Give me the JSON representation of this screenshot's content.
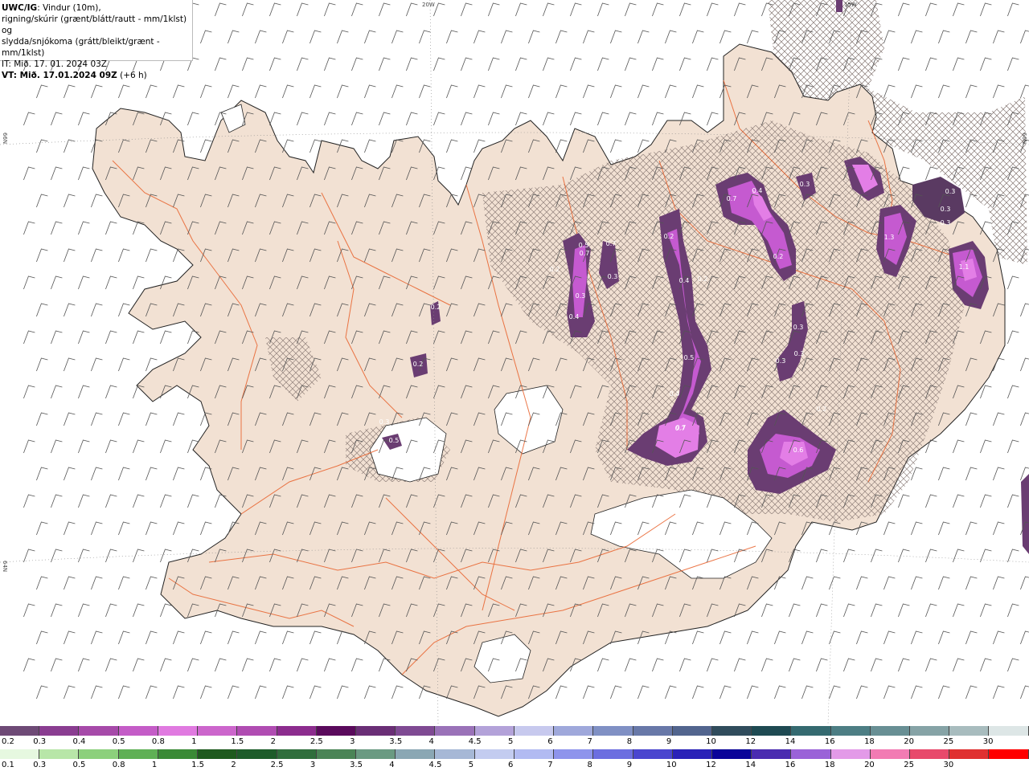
{
  "title": {
    "product": "UWC/IG",
    "line1_rest": ": Vindur (10m),",
    "line2": "rigning/skúrir (grænt/blátt/rautt - mm/1klst) og",
    "line3": "slydda/snjókoma (grátt/bleikt/grænt - mm/1klst)",
    "line4": "IT: Mið. 17. 01. 2024 03Z",
    "line5_bold": "VT: Mið. 17.01.2024 09Z",
    "line5_rest": " (+6 h)"
  },
  "grid_labels": {
    "top_20w": "20W",
    "top_15w": "15W",
    "left_66n": "66N",
    "right_66n": "66N",
    "left_64n": "64N"
  },
  "map_labels": [
    "0.7",
    "0.5",
    "0.2",
    "0.3",
    "0.3",
    "0.4",
    "0.7",
    "0.2",
    "0.2",
    "0.3",
    "0.5",
    "0.2",
    "0.4",
    "0.2",
    "0.5",
    "0.7",
    "0.4",
    "0.2",
    "0.7",
    "0.3",
    "0.3",
    "0.3",
    "1.3",
    "1.1",
    "0.3",
    "0.3",
    "0.3",
    "0.3",
    "0.4",
    "0.7",
    "0.6",
    "0.2"
  ],
  "legend_snow": {
    "labels": [
      "0.2",
      "0.3",
      "0.4",
      "0.5",
      "0.8",
      "1",
      "1.5",
      "2",
      "2.5",
      "3",
      "3.5",
      "4",
      "4.5",
      "5",
      "6",
      "7",
      "8",
      "9",
      "10",
      "12",
      "14",
      "16",
      "18",
      "20",
      "25",
      "30"
    ],
    "colors": [
      "#6e4a76",
      "#8a3d91",
      "#a64aa9",
      "#c45cc7",
      "#e07ae0",
      "#cc66cc",
      "#b04cb2",
      "#8c2c8e",
      "#5a0a5c",
      "#6a2e76",
      "#7f4a93",
      "#9a72b8",
      "#b3a2d9",
      "#c7c9ee",
      "#9fa8db",
      "#8090c4",
      "#6878a8",
      "#52658e",
      "#304c5c",
      "#1e4a52",
      "#356a70",
      "#4d7e84",
      "#688f94",
      "#86a3a6",
      "#a8bcbe",
      "#dde6e6"
    ]
  },
  "legend_rain": {
    "labels": [
      "0.1",
      "0.3",
      "0.5",
      "0.8",
      "1",
      "1.5",
      "2",
      "2.5",
      "3",
      "3.5",
      "4",
      "4.5",
      "5",
      "6",
      "7",
      "8",
      "9",
      "10",
      "12",
      "14",
      "16",
      "18",
      "20",
      "25",
      "30"
    ],
    "colors": [
      "#e6f8e0",
      "#b8e6a8",
      "#8cd07c",
      "#5fb055",
      "#3a8a36",
      "#1e5a1e",
      "#1d5c2a",
      "#2f6e3c",
      "#4a8456",
      "#6a9a82",
      "#8aa7b4",
      "#a6b8d6",
      "#c3ccf0",
      "#b2bbf2",
      "#8e94ec",
      "#6c6ee0",
      "#4a46cf",
      "#2a22b8",
      "#0a0499",
      "#4a2cb0",
      "#9a62d8",
      "#e39ae8",
      "#f27bb3",
      "#e8496b",
      "#e03030",
      "#ff0000"
    ]
  }
}
